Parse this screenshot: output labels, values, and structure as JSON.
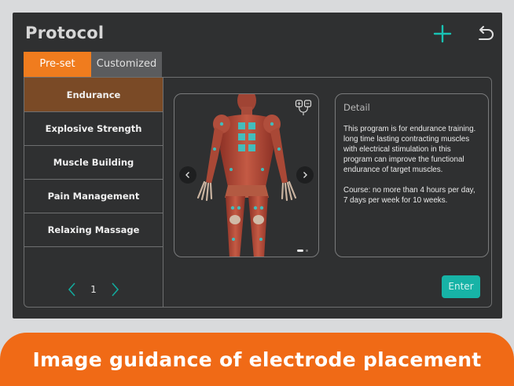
{
  "header": {
    "title": "Protocol",
    "add_icon": "plus-icon",
    "back_icon": "undo-arrow-icon"
  },
  "tabs": [
    {
      "label": "Pre-set",
      "active": true
    },
    {
      "label": "Customized",
      "active": false
    }
  ],
  "programs": [
    {
      "label": "Endurance",
      "active": true
    },
    {
      "label": "Explosive Strength",
      "active": false
    },
    {
      "label": "Muscle Building",
      "active": false
    },
    {
      "label": "Pain Management",
      "active": false
    },
    {
      "label": "Relaxing Massage",
      "active": false
    }
  ],
  "pager": {
    "page": "1"
  },
  "detail": {
    "title": "Detail",
    "description": "This program is for endurance training. long time lasting contracting muscles with electrical stimulation in this program can improve the functional endurance of target muscles.",
    "course": "Course: no more than 4 hours per day, 7 days per week for 10 weeks."
  },
  "enter_label": "Enter",
  "banner": {
    "text": "Image guidance of electrode placement"
  },
  "colors": {
    "accent": "#f07c1e",
    "teal": "#17b3a6",
    "background": "#2f3031"
  }
}
